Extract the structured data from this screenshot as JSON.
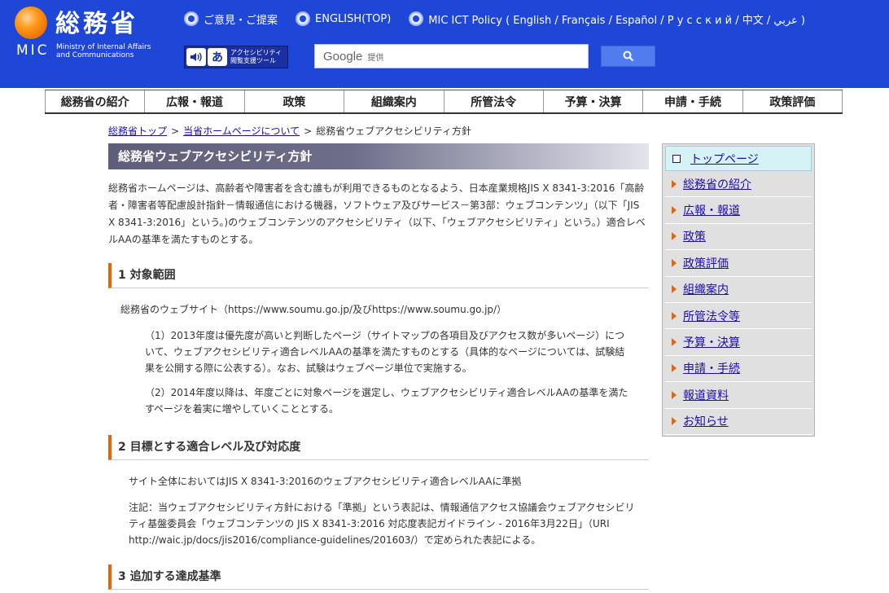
{
  "header": {
    "logo_kanji": "総務省",
    "logo_mic": "MIC",
    "logo_en_line1": "Ministry of Internal Affairs",
    "logo_en_line2": "and Communications",
    "toplinks": [
      {
        "label": "ご意見・ご提案"
      },
      {
        "label": "ENGLISH(TOP)"
      },
      {
        "label": "MIC ICT Policy ( English / Français / Español / Р у с с к и й / 中文 / عربي )"
      }
    ],
    "a11y_tool": {
      "line1": "アクセシビリティ",
      "line2": "閲覧支援ツール",
      "icon2_char": "あ"
    },
    "search": {
      "google_word": "Google",
      "provided": "提供"
    }
  },
  "nav": {
    "items": [
      "総務省の紹介",
      "広報・報道",
      "政策",
      "組織案内",
      "所管法令",
      "予算・決算",
      "申請・手続",
      "政策評価"
    ]
  },
  "breadcrumb": {
    "items": [
      "総務省トップ",
      "当省ホームページについて"
    ],
    "current": "総務省ウェブアクセシビリティ方針",
    "sep": ">"
  },
  "main": {
    "title": "総務省ウェブアクセシビリティ方針",
    "intro": "総務省ホームページは、高齢者や障害者を含む誰もが利用できるものとなるよう、日本産業規格JIS X 8341-3:2016「高齢者・障害者等配慮設計指針－情報通信における機器，ソフトウェア及びサービス－第3部：ウェブコンテンツ」（以下「JIS X 8341-3:2016」という。)のウェブコンテンツのアクセシビリティ（以下、「ウェブアクセシビリティ」という。）適合レベルAAの基準を満たすものとする。",
    "section1": {
      "heading": "1 対象範囲",
      "body": "総務省のウェブサイト（https://www.soumu.go.jp/及びhttps://www.soumu.go.jp/）",
      "item1": "（1）2013年度は優先度が高いと判断したページ（サイトマップの各項目及びアクセス数が多いページ）について、ウェブアクセシビリティ適合レベルAAの基準を満たすものとする（具体的なページについては、試験結果を公開する際に公表する）。なお、試験はウェブページ単位で実施する。",
      "item2": "（2）2014年度以降は、年度ごとに対象ページを選定し、ウェブアクセシビリティ適合レベルAAの基準を満たすページを着実に増やしていくこととする。"
    },
    "section2": {
      "heading": "2 目標とする適合レベル及び対応度",
      "body": "サイト全体においてはJIS X 8341-3:2016のウェブアクセシビリティ適合レベルAAに準拠",
      "note": "注記：当ウェブアクセシビリティ方針における「準拠」という表記は、情報通信アクセス協議会ウェブアクセシビリティ基盤委員会「ウェブコンテンツの JIS X 8341-3:2016 対応度表記ガイドライン - 2016年3月22日」（URI　http://waic.jp/docs/jis2016/compliance-guidelines/201603/）で定められた表記による。"
    },
    "section3": {
      "heading": "3 追加する達成基準"
    }
  },
  "sidebar": {
    "top": "トップページ",
    "items": [
      "総務省の紹介",
      "広報・報道",
      "政策",
      "政策評価",
      "組織案内",
      "所管法令等",
      "予算・決算",
      "申請・手続",
      "報道資料",
      "お知らせ"
    ]
  },
  "colors": {
    "header_blue": "#1e46d7",
    "accent_orange": "#e8630a",
    "link_blue": "#1a0dab"
  }
}
